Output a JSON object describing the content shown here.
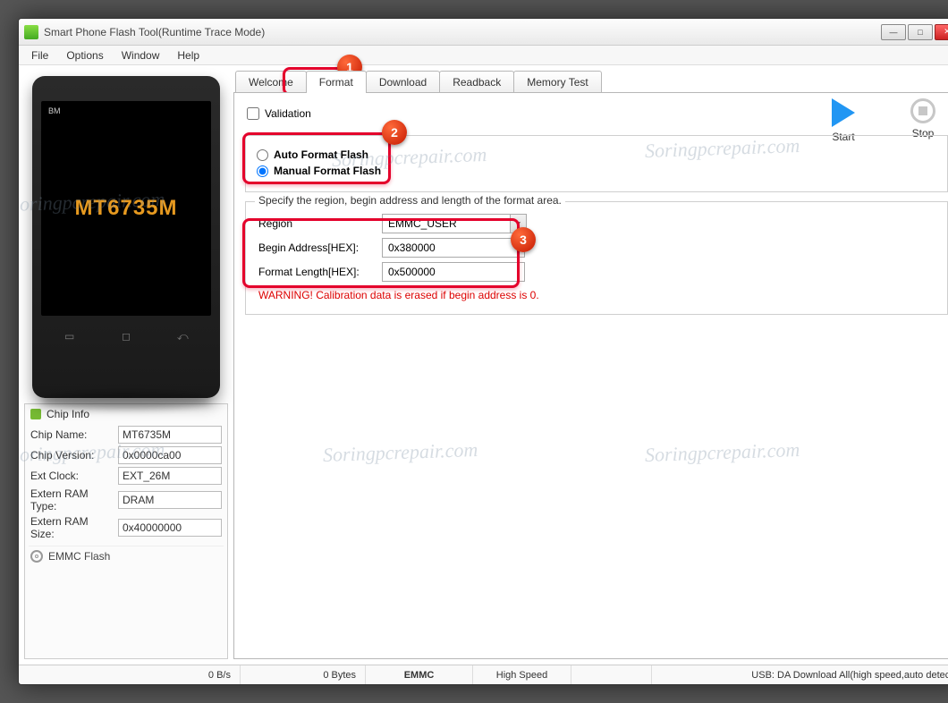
{
  "window": {
    "title": "Smart Phone Flash Tool(Runtime Trace Mode)"
  },
  "menu": [
    "File",
    "Options",
    "Window",
    "Help"
  ],
  "phone": {
    "bm": "BM",
    "chip": "MT6735M"
  },
  "chipinfo": {
    "title": "Chip Info",
    "rows": [
      {
        "label": "Chip Name:",
        "value": "MT6735M"
      },
      {
        "label": "Chip Version:",
        "value": "0x0000ca00"
      },
      {
        "label": "Ext Clock:",
        "value": "EXT_26M"
      },
      {
        "label": "Extern RAM Type:",
        "value": "DRAM"
      },
      {
        "label": "Extern RAM Size:",
        "value": "0x40000000"
      }
    ],
    "emmc": "EMMC Flash"
  },
  "tabs": [
    "Welcome",
    "Format",
    "Download",
    "Readback",
    "Memory Test"
  ],
  "validation_label": "Validation",
  "actions": {
    "start": "Start",
    "stop": "Stop"
  },
  "format_options": {
    "auto": "Auto Format Flash",
    "manual": "Manual Format Flash"
  },
  "spec": {
    "title": "Specify the region, begin address and length of the format area.",
    "region_label": "Region",
    "region_value": "EMMC_USER",
    "begin_label": "Begin Address[HEX]:",
    "begin_value": "0x380000",
    "length_label": "Format Length[HEX]:",
    "length_value": "0x500000",
    "warning": "WARNING! Calibration data is erased if begin address is 0."
  },
  "statusbar": {
    "rate": "0 B/s",
    "bytes": "0 Bytes",
    "storage": "EMMC",
    "speed": "High Speed",
    "usb": "USB: DA Download All(high speed,auto detect)"
  },
  "callouts": {
    "c1": "1",
    "c2": "2",
    "c3": "3"
  },
  "watermark": "Soringpcrepair.com"
}
